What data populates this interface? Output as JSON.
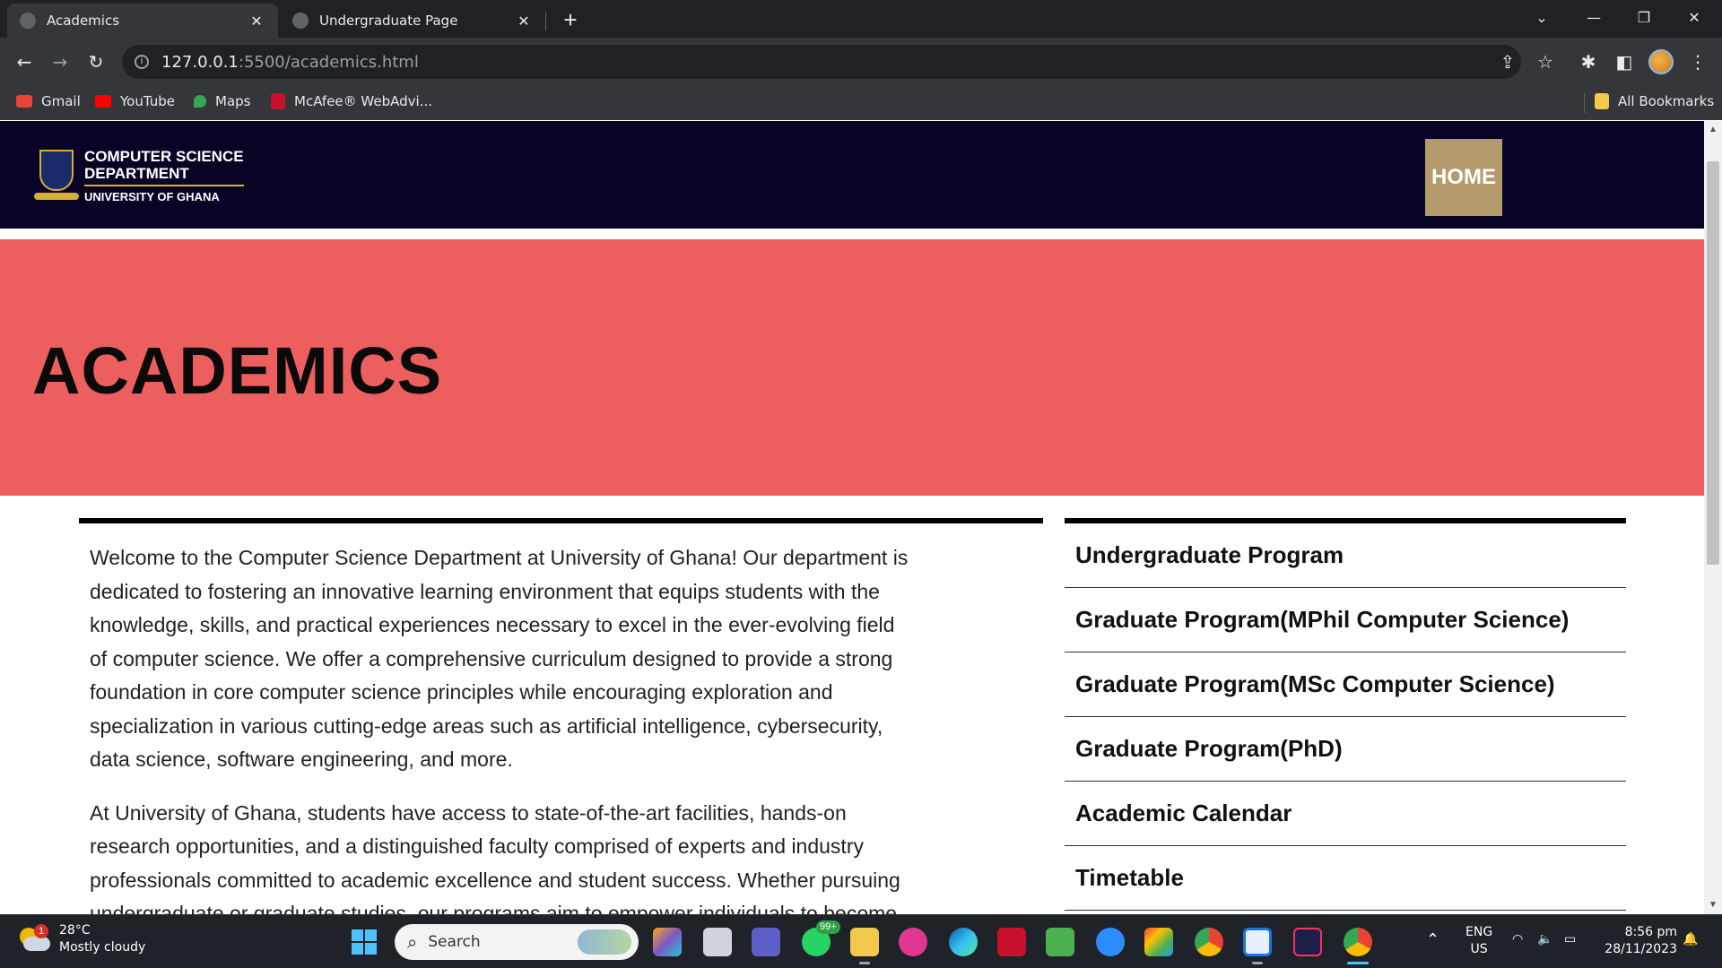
{
  "browser": {
    "tabs": [
      {
        "title": "Academics",
        "active": true
      },
      {
        "title": "Undergraduate Page",
        "active": false
      }
    ],
    "new_tab_symbol": "+",
    "url_host": "127.0.0.1",
    "url_rest": ":5500/academics.html",
    "bookmarks": [
      {
        "label": "Gmail",
        "icon": "gmail-icon",
        "color": "#ea4335"
      },
      {
        "label": "YouTube",
        "icon": "youtube-icon",
        "color": "#ff0000"
      },
      {
        "label": "Maps",
        "icon": "maps-icon",
        "color": "#34a853"
      },
      {
        "label": "McAfee® WebAdvi...",
        "icon": "mcafee-icon",
        "color": "#c8102e"
      }
    ],
    "all_bookmarks": "All Bookmarks"
  },
  "site": {
    "logo_line1": "COMPUTER SCIENCE",
    "logo_line2": "DEPARTMENT",
    "logo_line3": "UNIVERSITY OF GHANA",
    "home_button": "HOME",
    "hero_title": "ACADEMICS",
    "colors": {
      "header_bg": "#0b0326",
      "hero_bg": "#ed5e5e",
      "home_button_bg": "#b59a6b",
      "accent_gold": "#d4af37"
    },
    "paragraphs": [
      "Welcome to the Computer Science Department at University of Ghana! Our department is dedicated to fostering an innovative learning environment that equips students with the knowledge, skills, and practical experiences necessary to excel in the ever-evolving field of computer science. We offer a comprehensive curriculum designed to provide a strong foundation in core computer science principles while encouraging exploration and specialization in various cutting-edge areas such as artificial intelligence, cybersecurity, data science, software engineering, and more.",
      "At University of Ghana, students have access to state-of-the-art facilities, hands-on research opportunities, and a distinguished faculty comprised of experts and industry professionals committed to academic excellence and student success. Whether pursuing undergraduate or graduate studies, our programs aim to empower individuals to become adept problem"
    ],
    "sidebar_links": [
      "Undergraduate Program",
      "Graduate Program(MPhil Computer Science)",
      "Graduate Program(MSc Computer Science)",
      "Graduate Program(PhD)",
      "Academic Calendar",
      "Timetable"
    ]
  },
  "taskbar": {
    "weather_temp": "28°C",
    "weather_desc": "Mostly cloudy",
    "weather_badge": "1",
    "search_placeholder": "Search",
    "whatsapp_badge": "99+",
    "lang_line1": "ENG",
    "lang_line2": "US",
    "time": "8:56 pm",
    "date": "28/11/2023"
  }
}
